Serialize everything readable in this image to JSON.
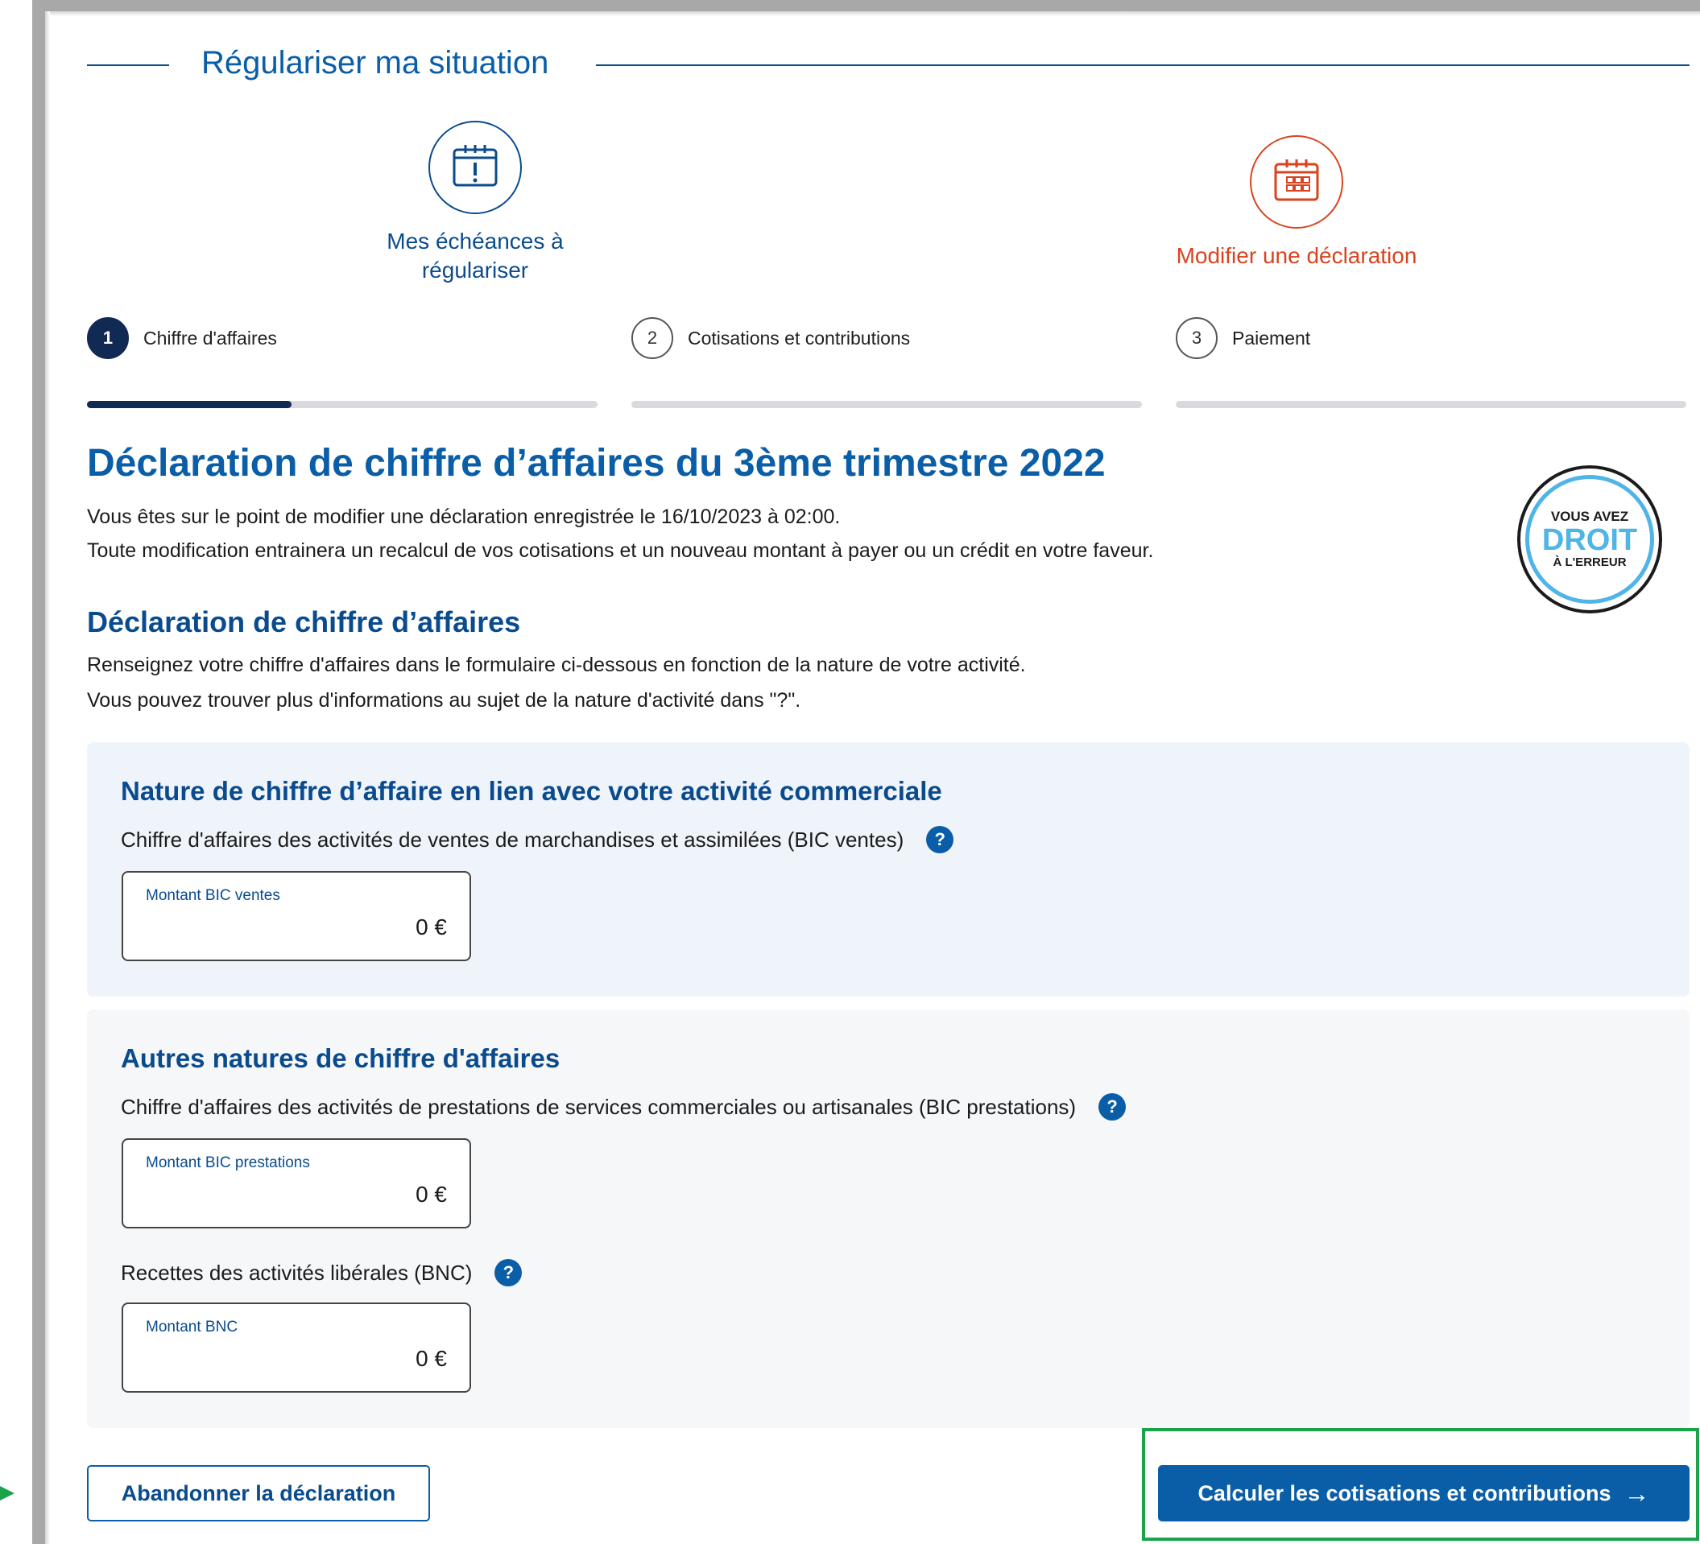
{
  "section": {
    "title": "Régulariser ma situation"
  },
  "choices": [
    {
      "label": "Mes échéances à régulariser",
      "icon": "calendar-alert-icon"
    },
    {
      "label": "Modifier une déclaration",
      "icon": "calendar-grid-icon"
    }
  ],
  "steps": [
    {
      "number": "1",
      "label": "Chiffre d'affaires"
    },
    {
      "number": "2",
      "label": "Cotisations et contributions"
    },
    {
      "number": "3",
      "label": "Paiement"
    }
  ],
  "progress": {
    "step1_fraction": 0.4
  },
  "heading": "Déclaration de chiffre d’affaires du 3ème trimestre 2022",
  "intro": {
    "line1": "Vous êtes sur le point de modifier une déclaration enregistrée le 16/10/2023 à 02:00.",
    "line2": "Toute modification entrainera un recalcul de vos cotisations et un nouveau montant à payer ou un crédit en votre faveur."
  },
  "badge": {
    "line1": "VOUS AVEZ",
    "line2": "DROIT",
    "line3": "À L'ERREUR"
  },
  "subheading": "Déclaration de chiffre d’affaires",
  "subintro": {
    "line1": "Renseignez votre chiffre d'affaires dans le formulaire ci-dessous en fonction de la nature de votre activité.",
    "line2": "Vous pouvez trouver plus d'informations au sujet de la nature d'activité dans \"?\"."
  },
  "panel_commercial": {
    "title": "Nature de chiffre d’affaire en lien avec votre activité commerciale",
    "field_label": "Chiffre d'affaires des activités de ventes de marchandises et assimilées (BIC ventes)",
    "input_label": "Montant BIC ventes",
    "input_value": "0 €"
  },
  "panel_other": {
    "title": "Autres natures de chiffre d'affaires",
    "field1_label": "Chiffre d'affaires des activités de prestations de services commerciales ou artisanales (BIC prestations)",
    "input1_label": "Montant BIC prestations",
    "input1_value": "0 €",
    "field2_label": "Recettes des activités libérales (BNC)",
    "input2_label": "Montant BNC",
    "input2_value": "0 €"
  },
  "help_glyph": "?",
  "buttons": {
    "abandon": "Abandonner la déclaration",
    "calculate": "Calculer les cotisations et contributions",
    "arrow": "→"
  },
  "colors": {
    "primary": "#0a5ea8",
    "dark_navy": "#112a54",
    "accent_orange": "#d7441f",
    "highlight_green": "#1aa34a",
    "badge_blue": "#4fb4e6"
  }
}
